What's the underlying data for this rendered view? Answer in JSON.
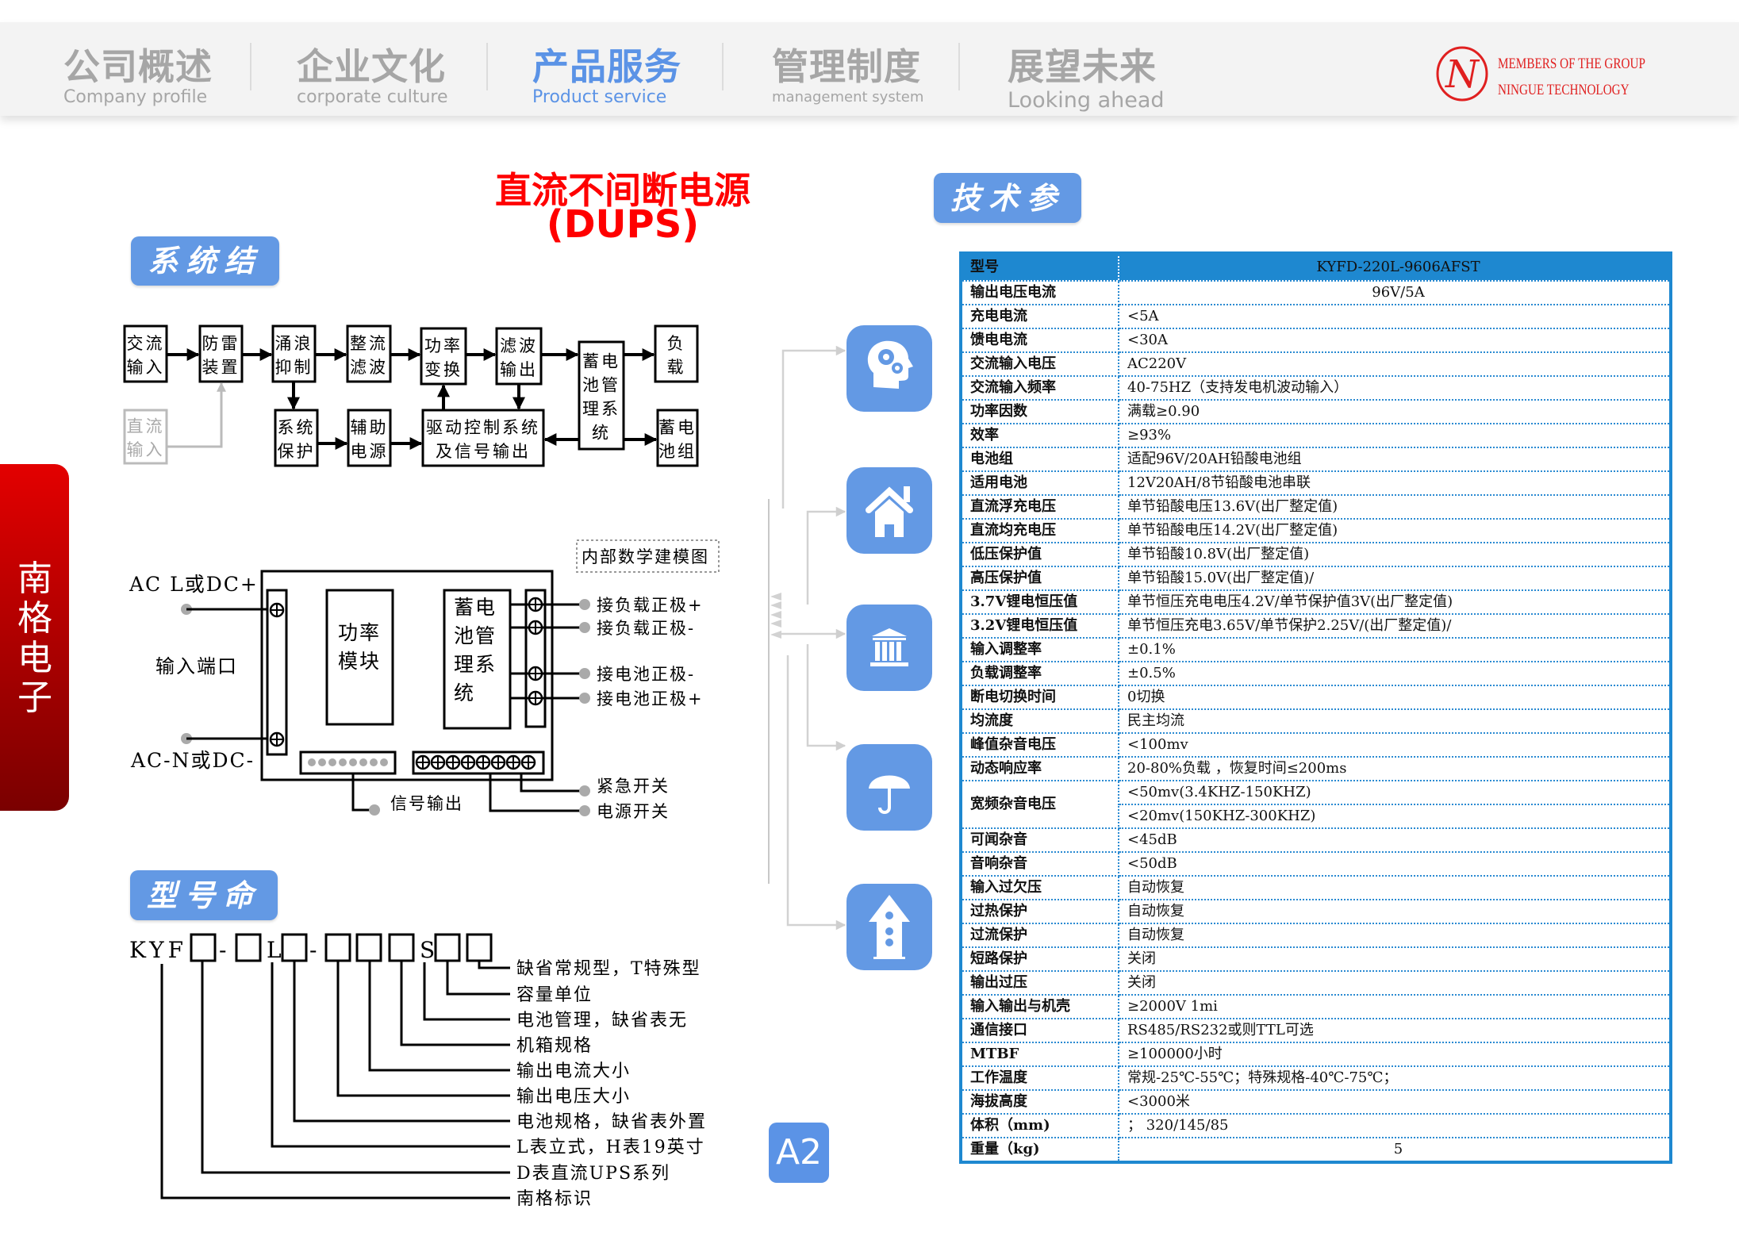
{
  "nav": [
    {
      "cn": "公司概述",
      "en": "Company profile",
      "active": false
    },
    {
      "cn": "企业文化",
      "en": "corporate culture",
      "active": false
    },
    {
      "cn": "产品服务",
      "en": "Product service",
      "active": true
    },
    {
      "cn": "管理制度",
      "en": "management system",
      "active": false
    },
    {
      "cn": "展望未来",
      "en": "Looking ahead",
      "active": false
    }
  ],
  "logo": {
    "letter": "N",
    "line1": "MEMBERS OF THE GROUP",
    "line2": "NINGUE    TECHNOLOGY"
  },
  "side_tab": "南格电子",
  "title": {
    "line1": "直流不间断电源",
    "line2": "(DUPS)"
  },
  "sections": {
    "structure": "系统结构",
    "params": "技术参数",
    "naming": "型号命名"
  },
  "block_diagram": [
    {
      "lines": [
        "交流",
        "输入"
      ],
      "muted": false
    },
    {
      "lines": [
        "防雷",
        "装置"
      ],
      "muted": false
    },
    {
      "lines": [
        "涌浪",
        "抑制"
      ],
      "muted": false
    },
    {
      "lines": [
        "整流",
        "滤波"
      ],
      "muted": false
    },
    {
      "lines": [
        "功率",
        "变换"
      ],
      "muted": false
    },
    {
      "lines": [
        "滤波",
        "输出"
      ],
      "muted": false
    },
    {
      "lines": [
        "蓄电",
        "池管",
        "理系",
        "统"
      ],
      "muted": false
    },
    {
      "lines": [
        "负",
        "载"
      ],
      "muted": false
    },
    {
      "lines": [
        "直流",
        "输入"
      ],
      "muted": true
    },
    {
      "lines": [
        "系统",
        "保护"
      ],
      "muted": false
    },
    {
      "lines": [
        "辅助",
        "电源"
      ],
      "muted": false
    },
    {
      "lines": [
        "驱动控制系统",
        "及信号输出"
      ],
      "muted": false
    },
    {
      "lines": [
        "蓄电",
        "池组"
      ],
      "muted": false
    }
  ],
  "internal": {
    "caption": "内部数学建模图",
    "ac_l": "AC L或DC+",
    "input_port": "输入端口",
    "ac_n": "AC-N或DC-",
    "power_module": [
      "功率",
      "模块"
    ],
    "bms": [
      "蓄电",
      "池管",
      "理系",
      "统"
    ],
    "terminals": [
      "接负载正极+",
      "接负载正极-",
      "接电池正极-",
      "接电池正极+"
    ],
    "signal_out": "信号输出",
    "emergency": "紧急开关",
    "power_switch": "电源开关"
  },
  "naming": {
    "code": [
      "KYF",
      "□",
      "-",
      "□",
      "L",
      "□",
      "-",
      "□",
      "□",
      "□",
      "S",
      "□",
      "□"
    ],
    "legend": [
      "缺省常规型，T特殊型",
      "容量单位",
      "电池管理，缺省表无",
      "机箱规格",
      "输出电流大小",
      "输出电压大小",
      "电池规格，缺省表外置",
      "L表立式，H表19英寸",
      "D表直流UPS系列",
      "南格标识"
    ]
  },
  "icons": [
    "head-gears-icon",
    "house-icon",
    "bank-icon",
    "umbrella-icon",
    "birdhouse-icon"
  ],
  "page_badge": "A2",
  "spec_table": {
    "header": {
      "key": "型号",
      "value": "KYFD-220L-9606AFST"
    },
    "rows": [
      {
        "key": "输出电压电流",
        "value": "96V/5A",
        "center": true
      },
      {
        "key": "充电电流",
        "value": "<5A"
      },
      {
        "key": "馈电电流",
        "value": "<30A"
      },
      {
        "key": "交流输入电压",
        "value": "AC220V"
      },
      {
        "key": "交流输入频率",
        "value": "40-75HZ（支持发电机波动输入）"
      },
      {
        "key": "功率因数",
        "value": "满载≥0.90"
      },
      {
        "key": "效率",
        "value": "≥93%"
      },
      {
        "key": "电池组",
        "value": "适配96V/20AH铅酸电池组"
      },
      {
        "key": "适用电池",
        "value": "12V20AH/8节铅酸电池串联"
      },
      {
        "key": "直流浮充电压",
        "value": "单节铅酸电压13.6V(出厂整定值)"
      },
      {
        "key": "直流均充电压",
        "value": "单节铅酸电压14.2V(出厂整定值)"
      },
      {
        "key": "低压保护值",
        "value": "单节铅酸10.8V(出厂整定值)"
      },
      {
        "key": "高压保护值",
        "value": "单节铅酸15.0V(出厂整定值)/"
      },
      {
        "key": "3.7V锂电恒压值",
        "value": "单节恒压充电电压4.2V/单节保护值3V(出厂整定值)"
      },
      {
        "key": "3.2V锂电恒压值",
        "value": "单节恒压充电3.65V/单节保护2.25V/(出厂整定值)/"
      },
      {
        "key": "输入调整率",
        "value": "±0.1%"
      },
      {
        "key": "负载调整率",
        "value": "±0.5%"
      },
      {
        "key": "断电切换时间",
        "value": "0切换"
      },
      {
        "key": "均流度",
        "value": "民主均流"
      },
      {
        "key": "峰值杂音电压",
        "value": "<100mv"
      },
      {
        "key": "动态响应率",
        "value": "20-80%负载 ，恢复时间≤200ms"
      },
      {
        "key": "宽频杂音电压",
        "values": [
          "<50mv(3.4KHZ-150KHZ)",
          "<20mv(150KHZ-300KHZ)"
        ]
      },
      {
        "key": "可闻杂音",
        "value": "<45dB"
      },
      {
        "key": "音响杂音",
        "value": "<50dB"
      },
      {
        "key": "输入过欠压",
        "value": "自动恢复"
      },
      {
        "key": "过热保护",
        "value": "自动恢复"
      },
      {
        "key": "过流保护",
        "value": "自动恢复"
      },
      {
        "key": "短路保护",
        "value": "关闭"
      },
      {
        "key": "输出过压",
        "value": "关闭"
      },
      {
        "key": "输入输出与机壳",
        "value": "≥2000V 1mi"
      },
      {
        "key": "通信接口",
        "value": "RS485/RS232或则TTL可选"
      },
      {
        "key": "MTBF",
        "value": "≥100000小时"
      },
      {
        "key": "工作温度",
        "value": "常规-25℃-55℃；特殊规格-40℃-75℃；"
      },
      {
        "key": "海拔高度",
        "value": "<3000米"
      },
      {
        "key": "体积（mm)",
        "value": "；        320/145/85"
      },
      {
        "key": "重量（kg)",
        "value": "5",
        "center": true
      }
    ]
  },
  "colors": {
    "accent": "#6399e4",
    "nav_active": "#5b93e6",
    "title_red": "#ff0000",
    "table_blue": "#1e88d0",
    "side_tab_top": "#e30000",
    "side_tab_bottom": "#7a0000"
  }
}
